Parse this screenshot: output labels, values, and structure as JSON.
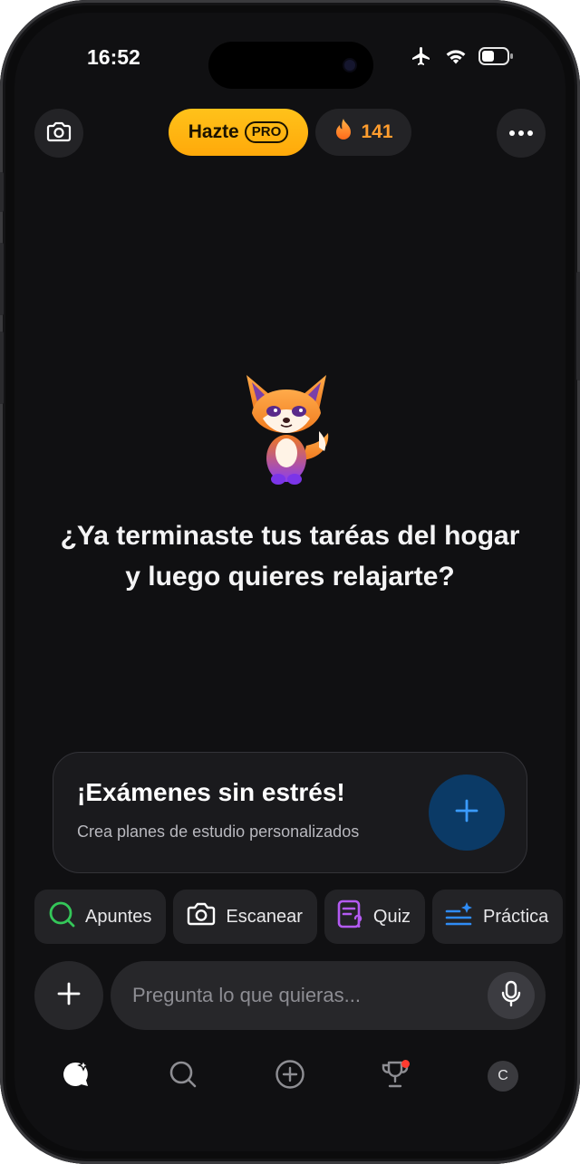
{
  "status_bar": {
    "time": "16:52"
  },
  "header": {
    "camera_icon": "camera-icon",
    "pro_label": "Hazte",
    "pro_badge": "PRO",
    "streak_icon": "flame-icon",
    "streak_count": "141",
    "more_icon": "more-dots-icon"
  },
  "main": {
    "mascot": "fox-mascot",
    "question": "¿Ya terminaste tus taréas del hogar y luego quieres relajarte?"
  },
  "promo_card": {
    "title": "¡Exámenes sin estrés!",
    "subtitle": "Crea planes de estudio personalizados",
    "action_icon": "plus-icon"
  },
  "quick_actions": [
    {
      "label": "Apuntes",
      "icon": "search-icon",
      "color": "#34c759"
    },
    {
      "label": "Escanear",
      "icon": "camera-icon",
      "color": "#ffffff"
    },
    {
      "label": "Quiz",
      "icon": "quiz-icon",
      "color": "#b45af2"
    },
    {
      "label": "Práctica",
      "icon": "practice-icon",
      "color": "#2f8cf5"
    }
  ],
  "composer": {
    "placeholder": "Pregunta lo que quieras...",
    "add_icon": "plus-icon",
    "mic_icon": "mic-icon"
  },
  "bottom_nav": {
    "items": [
      "chat-icon",
      "search-icon",
      "add-circle-icon",
      "trophy-icon",
      "avatar"
    ],
    "avatar_initial": "C"
  },
  "colors": {
    "accent_pro": "#ffb60f",
    "streak": "#ff9d2e",
    "primary_blue": "#0b3a66",
    "background": "#101012"
  }
}
